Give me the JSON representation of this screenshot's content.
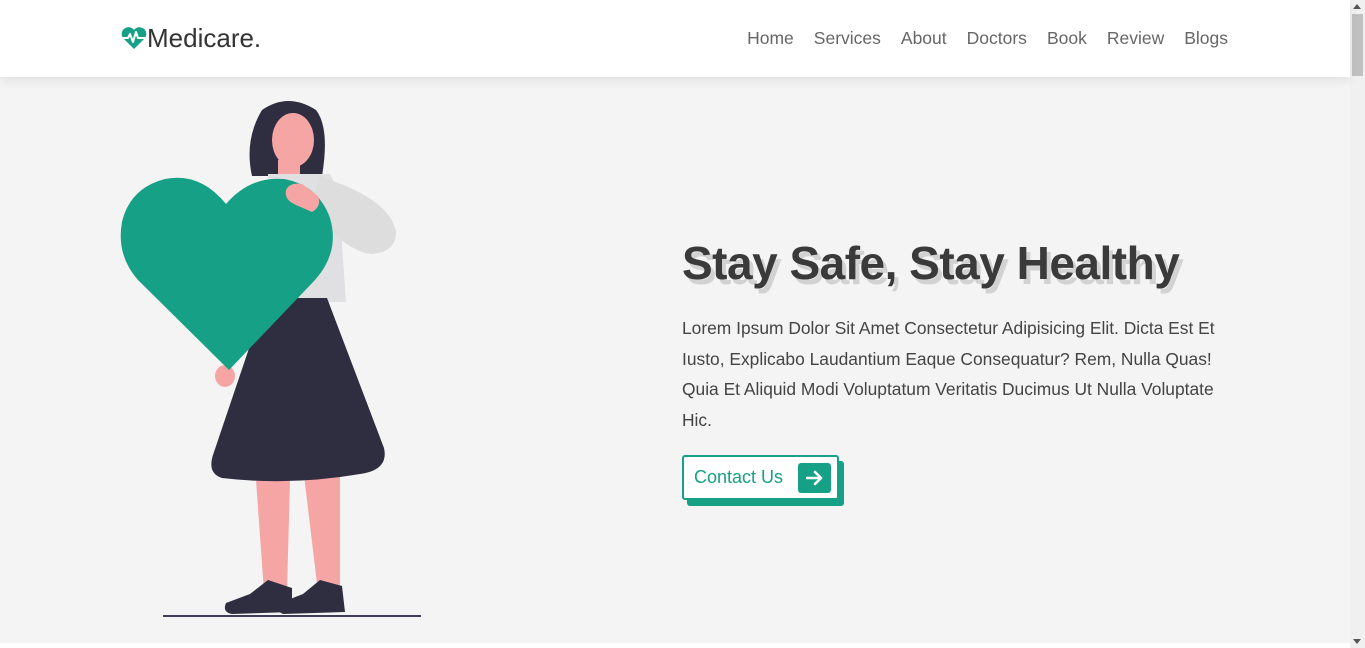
{
  "brand": {
    "name": "Medicare.",
    "icon": "heart-pulse-icon"
  },
  "nav": {
    "items": [
      {
        "label": "Home"
      },
      {
        "label": "Services"
      },
      {
        "label": "About"
      },
      {
        "label": "Doctors"
      },
      {
        "label": "Book"
      },
      {
        "label": "Review"
      },
      {
        "label": "Blogs"
      }
    ]
  },
  "hero": {
    "title": "Stay Safe, Stay Healthy",
    "description": "Lorem Ipsum Dolor Sit Amet Consectetur Adipisicing Elit. Dicta Est Et Iusto, Explicabo Laudantium Eaque Consequatur? Rem, Nulla Quas! Quia Et Aliquid Modi Voluptatum Veritatis Ducimus Ut Nulla Voluptate Hic.",
    "cta_label": "Contact Us",
    "cta_icon": "arrow-right-icon",
    "illustration_icon": "woman-holding-heart-illustration"
  },
  "colors": {
    "accent": "#16a085",
    "title": "#3a3a3a",
    "text": "#444444",
    "background": "#f4f4f4"
  }
}
